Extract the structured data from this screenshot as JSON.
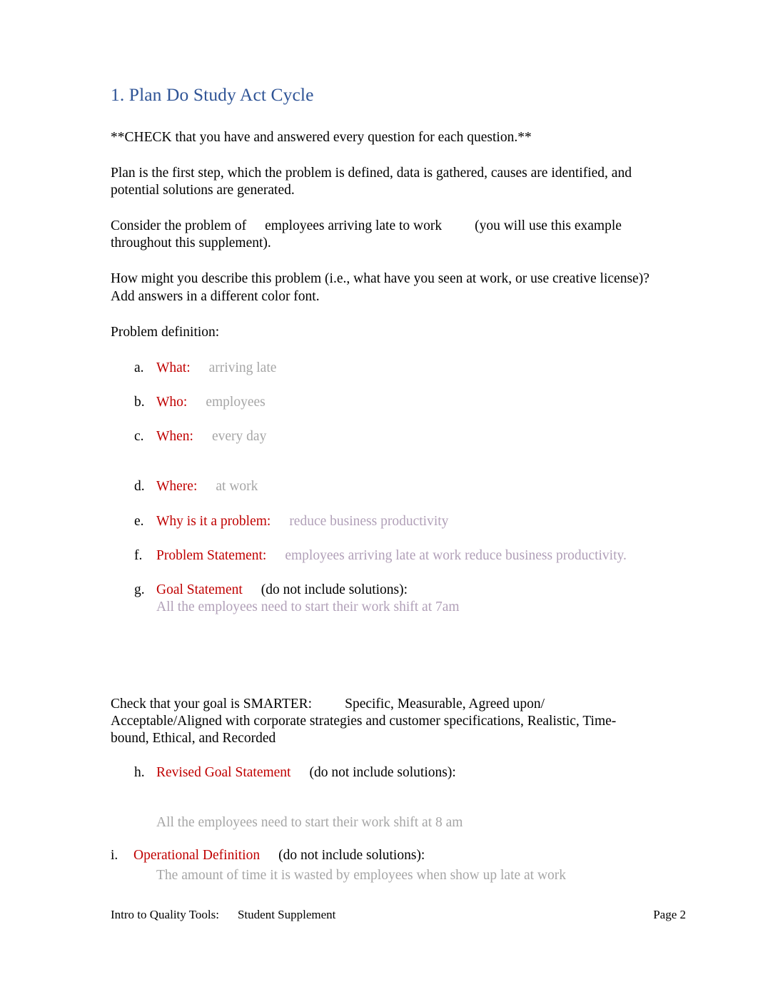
{
  "document": {
    "title": "1. Plan Do Study Act Cycle",
    "check_note": "**CHECK that you have and answered every question for each question.**",
    "plan_paragraph": "Plan is the first step, which the problem is defined, data is gathered, causes are identified, and potential solutions are generated.",
    "consider_prefix": "Consider the problem of",
    "consider_emphasis": "employees arriving late to work",
    "consider_suffix": "(you will use this example throughout this supplement).",
    "how_might_question": "How might you describe this problem (i.e., what have you seen at work, or use creative license)?",
    "add_answers_note": "Add answers in a different color font.",
    "problem_definition_heading": "Problem definition:",
    "items": [
      {
        "marker": "a.",
        "label": "What:",
        "answer": "arriving late"
      },
      {
        "marker": "b.",
        "label": "Who:",
        "answer": "employees"
      },
      {
        "marker": "c.",
        "label": "When:",
        "answer": "every day"
      },
      {
        "marker": "d.",
        "label": "Where:",
        "answer": "at work"
      },
      {
        "marker": "e.",
        "label": "Why is it a problem:",
        "answer": "reduce business productivity"
      },
      {
        "marker": "f.",
        "label": "Problem Statement:",
        "answer": "employees arriving late at work reduce business productivity."
      },
      {
        "marker": "g.",
        "label": "Goal Statement",
        "note": "(do not include solutions):",
        "answer": "All the employees need to start their work shift at 7am"
      }
    ],
    "smarter_line1_prefix": "Check that your goal is SMARTER:",
    "smarter_line1_suffix": "Specific, Measurable, Agreed upon/",
    "smarter_line2": "Acceptable/Aligned with corporate strategies and customer specifications, Realistic, Time-bound, Ethical, and Recorded",
    "revised_goal": {
      "marker": "h.",
      "label": "Revised Goal Statement",
      "note": "(do not include solutions):",
      "answer": "All the employees need to start their work shift at 8 am"
    },
    "operational_definition": {
      "marker": "i.",
      "label": "Operational Definition",
      "note": "(do not include solutions):",
      "bullet_glyph": "",
      "answer": "The amount of time it is wasted by employees when show up late at work"
    },
    "footer": {
      "left_part1": "Intro to Quality Tools:",
      "left_part2": "Student Supplement",
      "right": "Page 2"
    }
  }
}
